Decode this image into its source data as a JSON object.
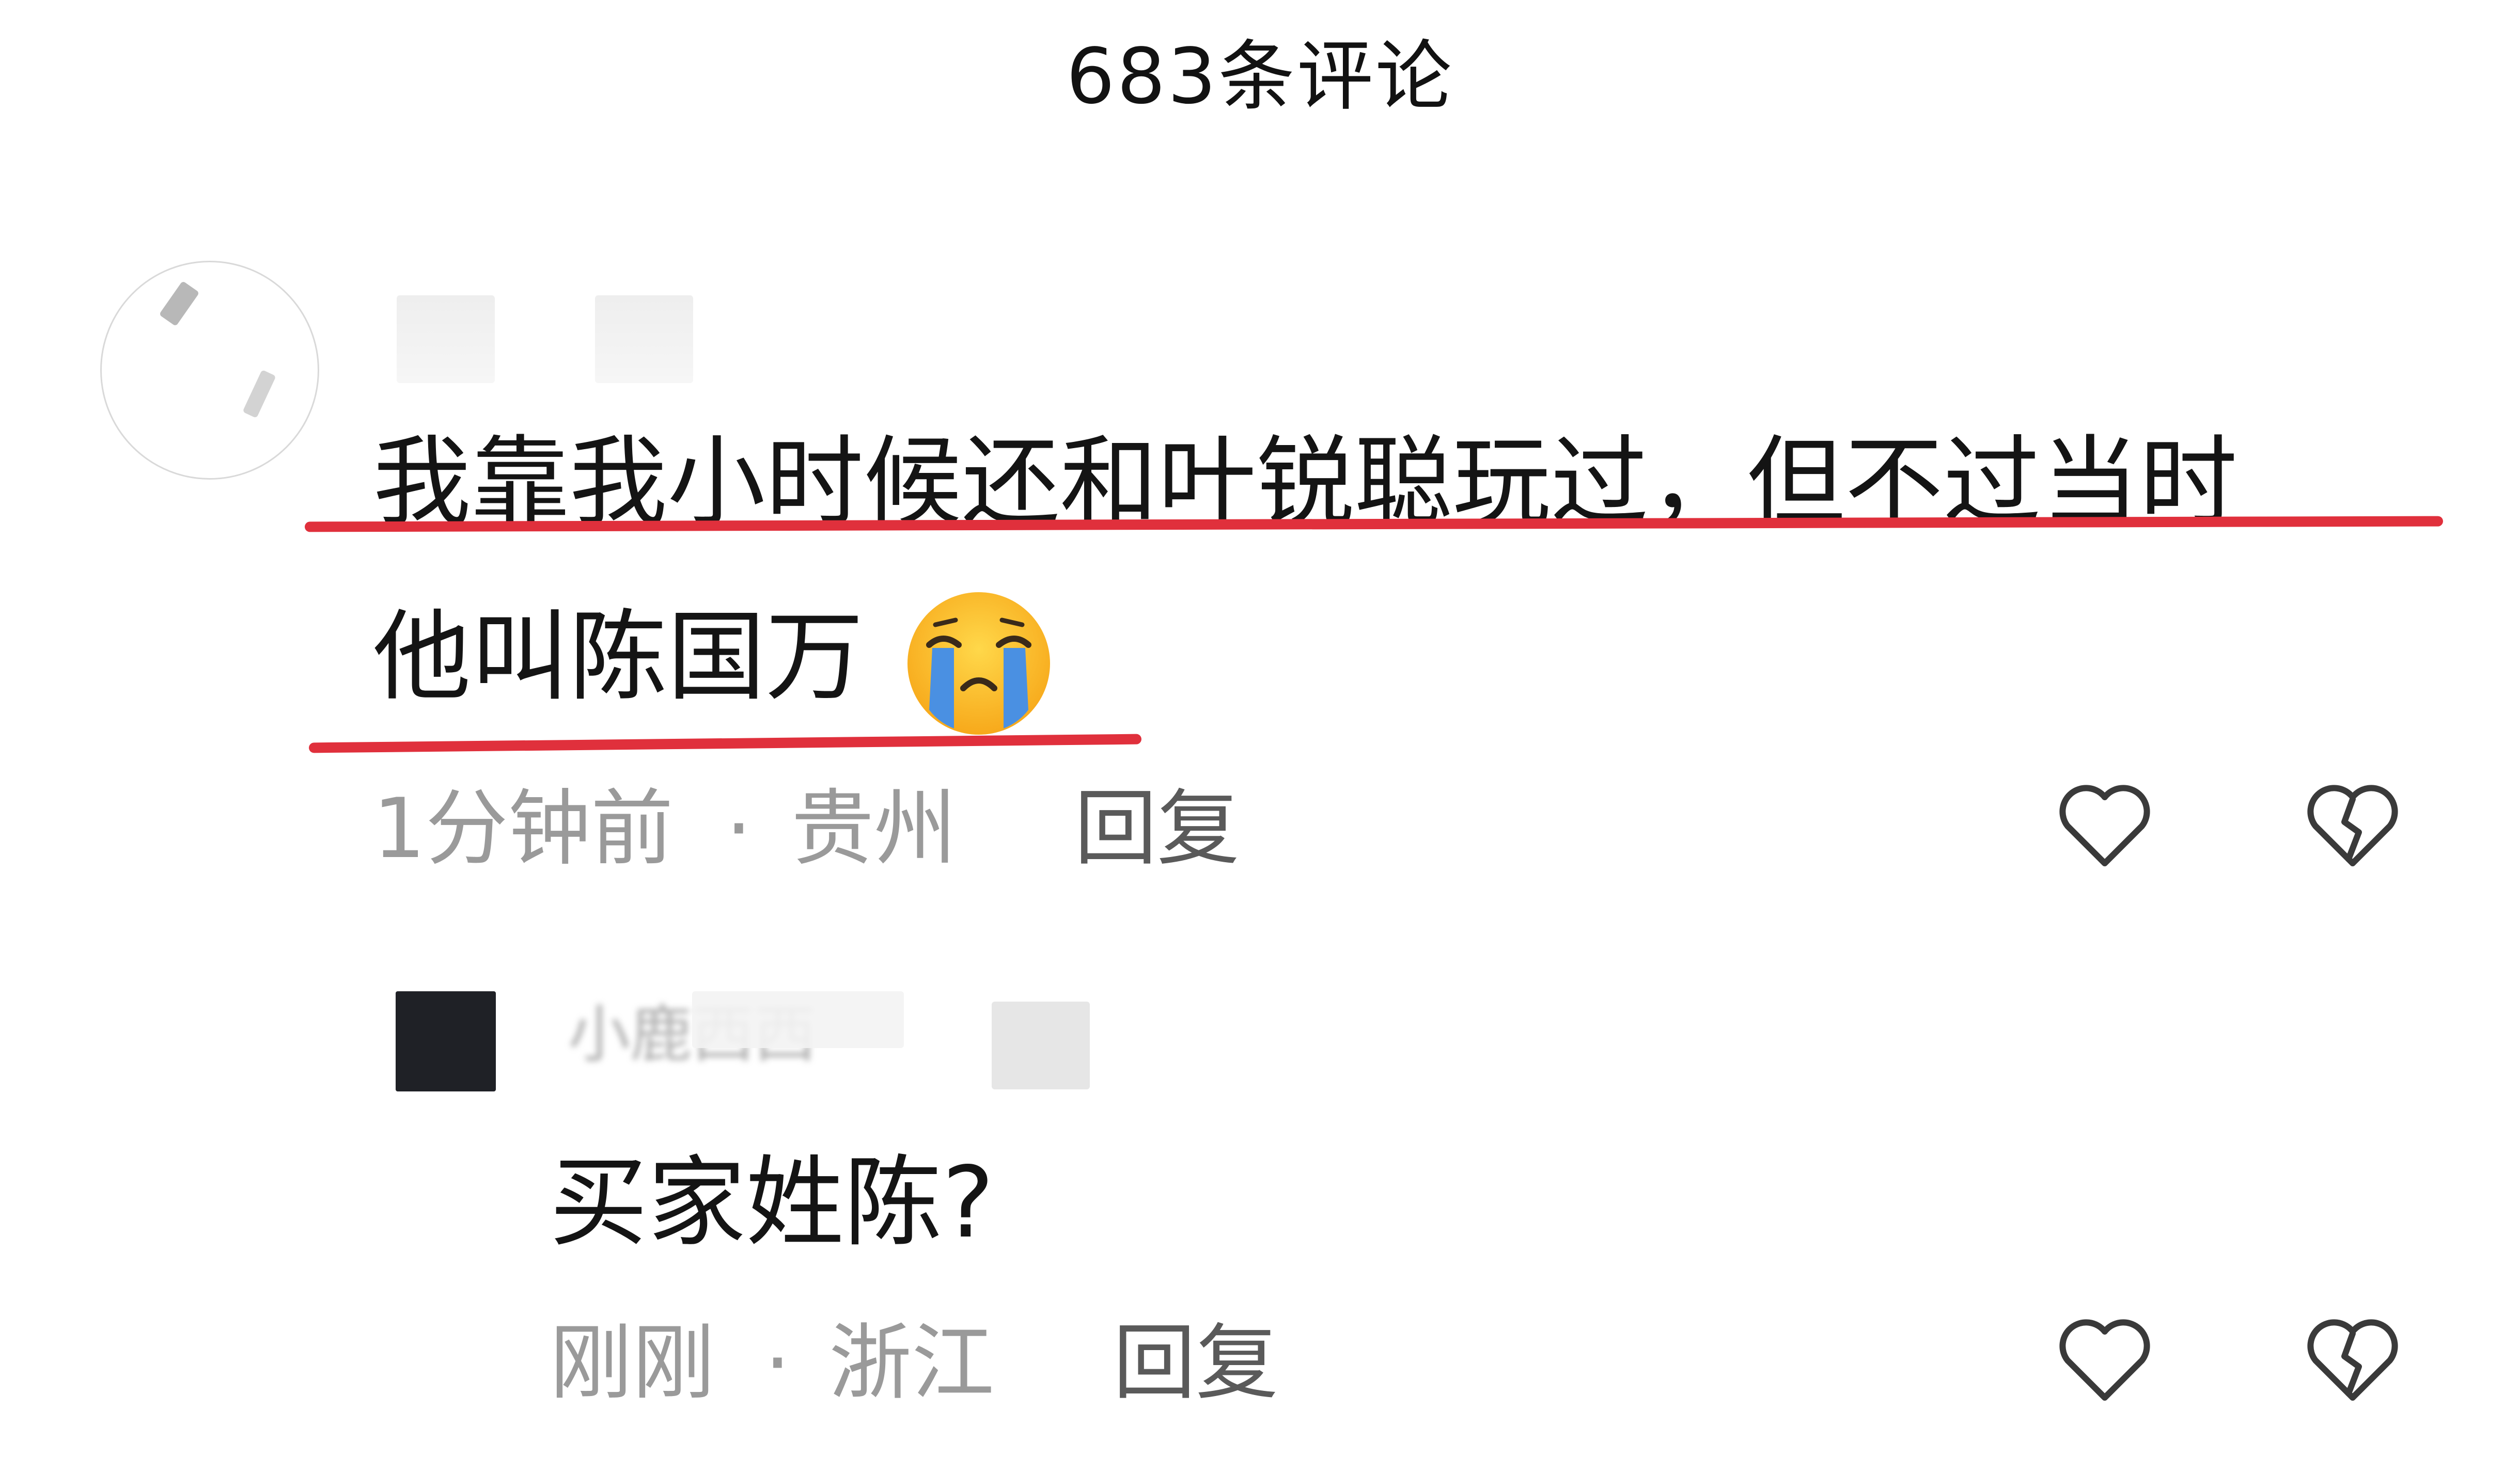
{
  "header": {
    "title": "683条评论"
  },
  "comments": [
    {
      "line1": "我靠我小时候还和叶锐聪玩过，但不过当时",
      "line2": "他叫陈国万",
      "emoji": "loudly-crying-face",
      "time": "1分钟前",
      "location": "贵州",
      "separator": "·",
      "reply_label": "回复",
      "like_icon": "heart-outline-icon",
      "dislike_icon": "broken-heart-icon"
    },
    {
      "username": "小鹿西西",
      "text": "买家姓陈?",
      "time": "刚刚",
      "location": "浙江",
      "separator": "·",
      "reply_label": "回复",
      "like_icon": "heart-outline-icon",
      "dislike_icon": "broken-heart-icon"
    }
  ],
  "colors": {
    "underline": "#e0303c",
    "meta": "#9a9a9a",
    "text": "#141414"
  }
}
